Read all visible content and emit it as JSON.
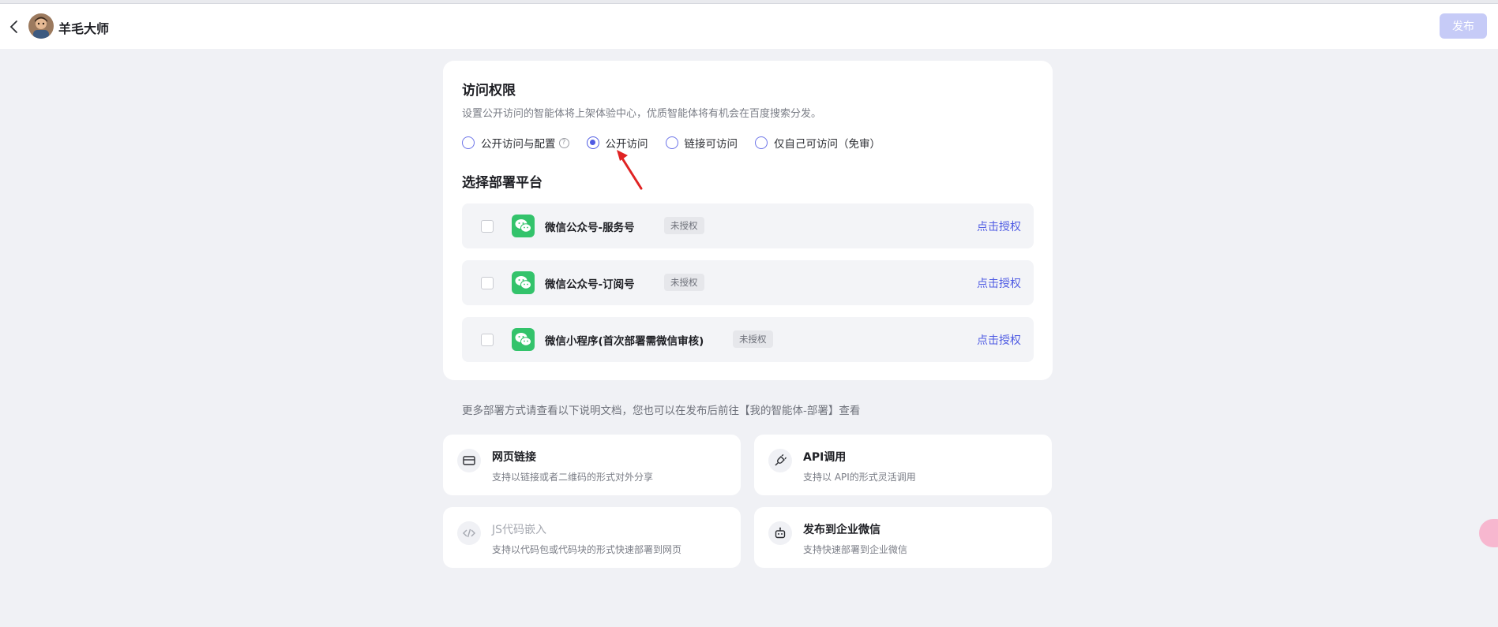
{
  "header": {
    "title": "羊毛大师",
    "publish_label": "发布"
  },
  "access": {
    "title": "访问权限",
    "description": "设置公开访问的智能体将上架体验中心，优质智能体将有机会在百度搜索分发。",
    "options": [
      {
        "label": "公开访问与配置",
        "selected": false
      },
      {
        "label": "公开访问",
        "selected": true
      },
      {
        "label": "链接可访问",
        "selected": false
      },
      {
        "label": "仅自己可访问（免审）",
        "selected": false
      }
    ]
  },
  "platforms": {
    "title": "选择部署平台",
    "items": [
      {
        "name": "微信公众号-服务号",
        "status": "未授权",
        "action": "点击授权"
      },
      {
        "name": "微信公众号-订阅号",
        "status": "未授权",
        "action": "点击授权"
      },
      {
        "name": "微信小程序(首次部署需微信审核)",
        "status": "未授权",
        "action": "点击授权"
      }
    ]
  },
  "more": {
    "description": "更多部署方式请查看以下说明文档，您也可以在发布后前往【我的智能体-部署】查看",
    "methods": [
      {
        "title": "网页链接",
        "subtitle": "支持以链接或者二维码的形式对外分享",
        "icon": "card-icon"
      },
      {
        "title": "API调用",
        "subtitle": "支持以 API的形式灵活调用",
        "icon": "plug-icon"
      },
      {
        "title": "JS代码嵌入",
        "subtitle": "支持以代码包或代码块的形式快速部署到网页",
        "icon": "code-icon"
      },
      {
        "title": "发布到企业微信",
        "subtitle": "支持快速部署到企业微信",
        "icon": "robot-icon"
      }
    ]
  },
  "colors": {
    "accent": "#4f5be3",
    "wechat_green": "#33c36b",
    "annotation_arrow": "#e02323"
  }
}
